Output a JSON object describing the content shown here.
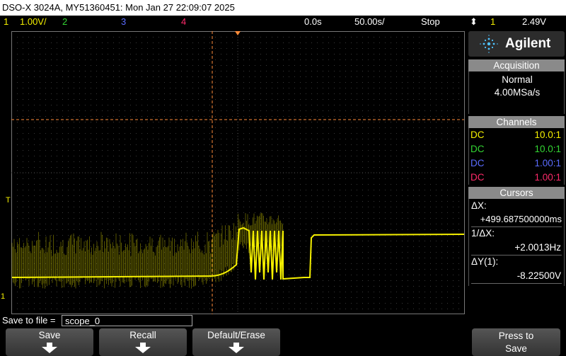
{
  "title": "DSO-X 3024A, MY51360451: Mon Jan 27 22:09:07 2025",
  "status": {
    "ch1_num": "1",
    "ch1_scale": "1.00V/",
    "ch2_num": "2",
    "ch3_num": "3",
    "ch4_num": "4",
    "time_offset": "0.0s",
    "time_scale": "50.00s/",
    "run_state": "Stop",
    "trig_source": "1",
    "trig_level": "2.49V"
  },
  "screen": {
    "trigger_marker": "T",
    "ground_marker": "1"
  },
  "panel": {
    "brand": "Agilent",
    "acquisition": {
      "header": "Acquisition",
      "mode": "Normal",
      "rate": "4.00MSa/s"
    },
    "channels": {
      "header": "Channels",
      "rows": [
        {
          "coupling": "DC",
          "probe": "10.0:1",
          "color": "#f5f000"
        },
        {
          "coupling": "DC",
          "probe": "10.0:1",
          "color": "#33d633"
        },
        {
          "coupling": "DC",
          "probe": "1.00:1",
          "color": "#5a6cff"
        },
        {
          "coupling": "DC",
          "probe": "1.00:1",
          "color": "#ff2a6a"
        }
      ]
    },
    "cursors": {
      "header": "Cursors",
      "dx_label": "ΔX:",
      "dx_value": "+499.687500000ms",
      "inv_label": "1/ΔX:",
      "inv_value": "+2.0013Hz",
      "dy_label": "ΔY(1):",
      "dy_value": "-8.22500V"
    }
  },
  "save": {
    "label": "Save to file =",
    "filename": "scope_0"
  },
  "softkeys": {
    "save": "Save",
    "recall": "Recall",
    "default": "Default/Erase",
    "press_line1": "Press to",
    "press_line2": "Save"
  },
  "colors": {
    "ch1": "#f5f000",
    "ch2": "#33d633",
    "ch3": "#5a6cff",
    "ch4": "#ff2a6a",
    "cursor": "#ff8c3a"
  }
}
